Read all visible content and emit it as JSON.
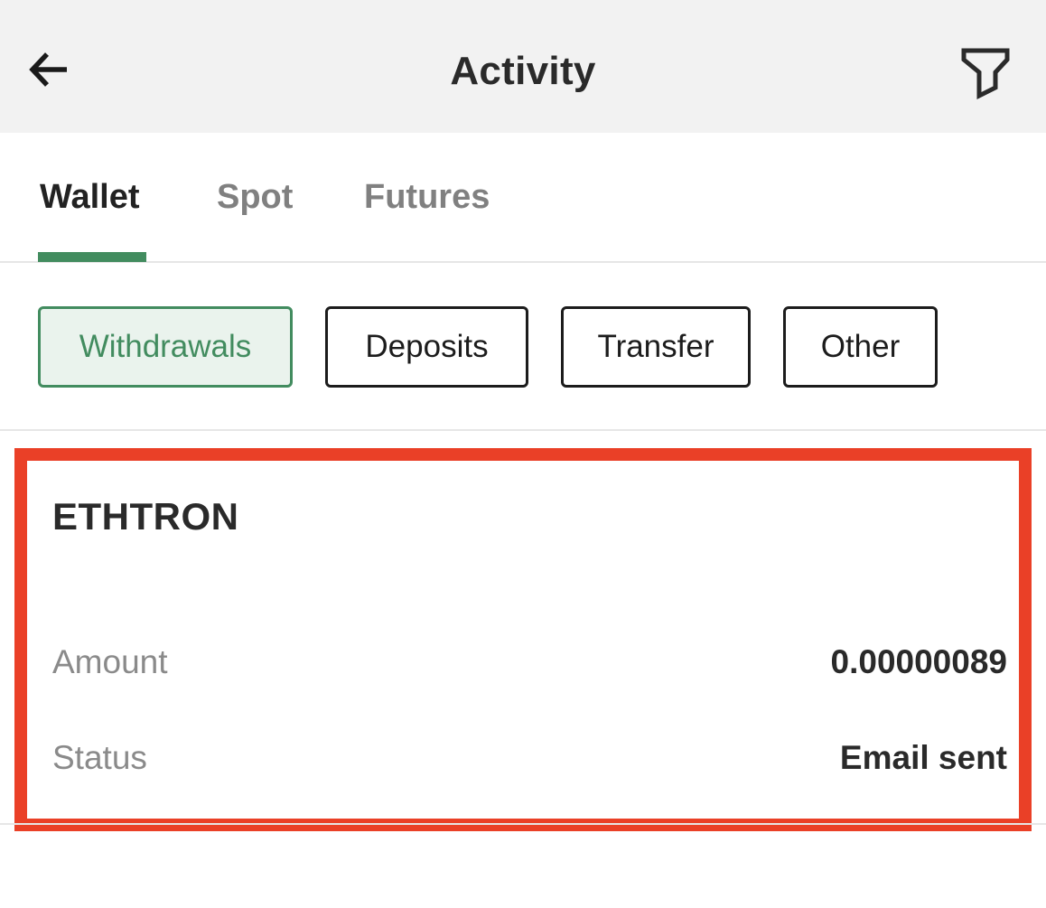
{
  "header": {
    "title": "Activity",
    "back_icon": "arrow-left-icon",
    "filter_icon": "funnel-filter-icon"
  },
  "tabs": [
    {
      "label": "Wallet",
      "active": true
    },
    {
      "label": "Spot",
      "active": false
    },
    {
      "label": "Futures",
      "active": false
    }
  ],
  "filters": [
    {
      "label": "Withdrawals",
      "selected": true
    },
    {
      "label": "Deposits",
      "selected": false
    },
    {
      "label": "Transfer",
      "selected": false
    },
    {
      "label": "Other",
      "selected": false
    }
  ],
  "transaction": {
    "coin": "ETHTRON",
    "amount_label": "Amount",
    "amount_value": "0.00000089",
    "status_label": "Status",
    "status_value": "Email sent"
  },
  "colors": {
    "accent": "#428c5f",
    "accent_bg": "#eaf3ed",
    "highlight_border": "#ea4027",
    "header_bg": "#f2f2f2"
  }
}
